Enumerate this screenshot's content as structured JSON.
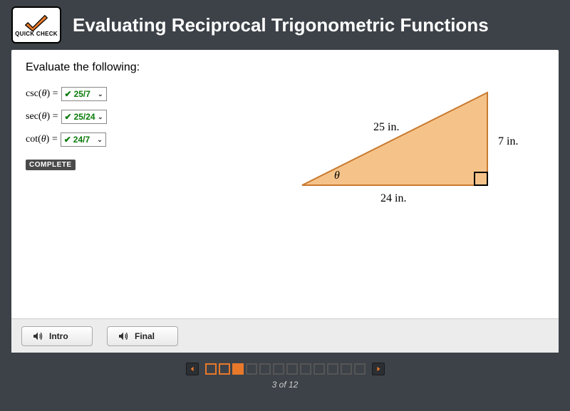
{
  "header": {
    "logo_label": "QUICK CHECK",
    "title": "Evaluating Reciprocal Trigonometric Functions"
  },
  "content": {
    "prompt": "Evaluate the following:",
    "answers": [
      {
        "func": "csc",
        "theta": "θ",
        "value": "25/7"
      },
      {
        "func": "sec",
        "theta": "θ",
        "value": "25/24"
      },
      {
        "func": "cot",
        "theta": "θ",
        "value": "24/7"
      }
    ],
    "complete_label": "COMPLETE",
    "triangle": {
      "hypotenuse": "25 in.",
      "opposite": "7 in.",
      "adjacent": "24 in.",
      "angle": "θ"
    }
  },
  "audio_buttons": {
    "intro": "Intro",
    "final": "Final"
  },
  "pager": {
    "total": 12,
    "current": 3,
    "counter_text": "3 of 12"
  }
}
